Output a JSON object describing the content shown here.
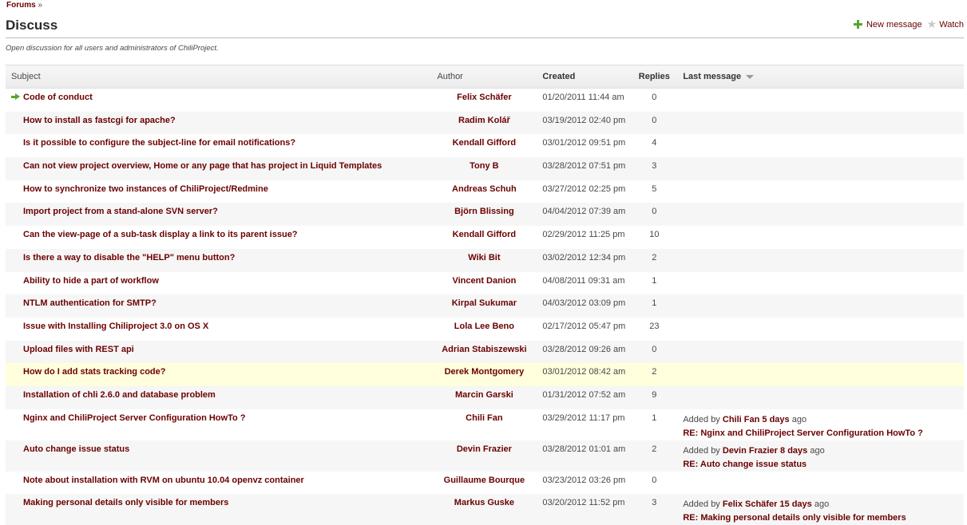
{
  "breadcrumb": {
    "link": "Forums",
    "separator": "»"
  },
  "page_title": "Discuss",
  "actions": {
    "new_message": "New message",
    "watch": "Watch"
  },
  "description": "Open discussion for all users and administrators of ChiliProject.",
  "table": {
    "headers": {
      "subject": "Subject",
      "author": "Author",
      "created": "Created",
      "replies": "Replies",
      "last_message": "Last message"
    },
    "rows": [
      {
        "subject": "Code of conduct",
        "author": "Felix Schäfer",
        "created": "01/20/2011 11:44 am",
        "replies": "0",
        "sticky": true
      },
      {
        "subject": "How to install as fastcgi for apache?",
        "author": "Radim Kolář",
        "created": "03/19/2012 02:40 pm",
        "replies": "0"
      },
      {
        "subject": "Is it possible to configure the subject-line for email notifications?",
        "author": "Kendall Gifford",
        "created": "03/01/2012 09:51 pm",
        "replies": "4"
      },
      {
        "subject": "Can not view project overview, Home or any page that has project in Liquid Templates",
        "author": "Tony B",
        "created": "03/28/2012 07:51 pm",
        "replies": "3"
      },
      {
        "subject": "How to synchronize two instances of ChiliProject/Redmine",
        "author": "Andreas Schuh",
        "created": "03/27/2012 02:25 pm",
        "replies": "5"
      },
      {
        "subject": "Import project from a stand-alone SVN server?",
        "author": "Björn Blissing",
        "created": "04/04/2012 07:39 am",
        "replies": "0"
      },
      {
        "subject": "Can the view-page of a sub-task display a link to its parent issue?",
        "author": "Kendall Gifford",
        "created": "02/29/2012 11:25 pm",
        "replies": "10"
      },
      {
        "subject": "Is there a way to disable the \"HELP\" menu button?",
        "author": "Wiki Bit",
        "created": "03/02/2012 12:34 pm",
        "replies": "2"
      },
      {
        "subject": "Ability to hide a part of workflow",
        "author": "Vincent Danion",
        "created": "04/08/2011 09:31 am",
        "replies": "1"
      },
      {
        "subject": "NTLM authentication for SMTP?",
        "author": "Kirpal Sukumar",
        "created": "04/03/2012 03:09 pm",
        "replies": "1"
      },
      {
        "subject": "Issue with Installing Chiliproject 3.0 on OS X",
        "author": "Lola Lee Beno",
        "created": "02/17/2012 05:47 pm",
        "replies": "23"
      },
      {
        "subject": "Upload files with REST api",
        "author": "Adrian Stabiszewski",
        "created": "03/28/2012 09:26 am",
        "replies": "0"
      },
      {
        "subject": "How do I add stats tracking code?",
        "author": "Derek Montgomery",
        "created": "03/01/2012 08:42 am",
        "replies": "2",
        "highlight": true
      },
      {
        "subject": "Installation of chli 2.6.0 and database problem",
        "author": "Marcin Garski",
        "created": "01/31/2012 07:52 am",
        "replies": "9"
      },
      {
        "subject": "Nginx and ChiliProject Server Configuration HowTo ?",
        "author": "Chili Fan",
        "created": "03/29/2012 11:17 pm",
        "replies": "1",
        "last": {
          "prefix": "Added by",
          "author": "Chili Fan",
          "ago": "5 days",
          "suffix": "ago",
          "subject": "RE: Nginx and ChiliProject Server Configuration HowTo ?"
        }
      },
      {
        "subject": "Auto change issue status",
        "author": "Devin Frazier",
        "created": "03/28/2012 01:01 am",
        "replies": "2",
        "last": {
          "prefix": "Added by",
          "author": "Devin Frazier",
          "ago": "8 days",
          "suffix": "ago",
          "subject": "RE: Auto change issue status"
        }
      },
      {
        "subject": "Note about installation with RVM on ubuntu 10.04 openvz container",
        "author": "Guillaume Bourque",
        "created": "03/23/2012 03:26 pm",
        "replies": "0"
      },
      {
        "subject": "Making personal details only visible for members",
        "author": "Markus Guske",
        "created": "03/20/2012 11:52 pm",
        "replies": "3",
        "last": {
          "prefix": "Added by",
          "author": "Felix Schäfer",
          "ago": "15 days",
          "suffix": "ago",
          "subject": "RE: Making personal details only visible for members"
        }
      }
    ]
  },
  "colors": {
    "link": "#6b0000",
    "accent_green": "#5aa42e",
    "row_alt": "#f6f6f6",
    "row_highlight": "#ffffdd"
  }
}
